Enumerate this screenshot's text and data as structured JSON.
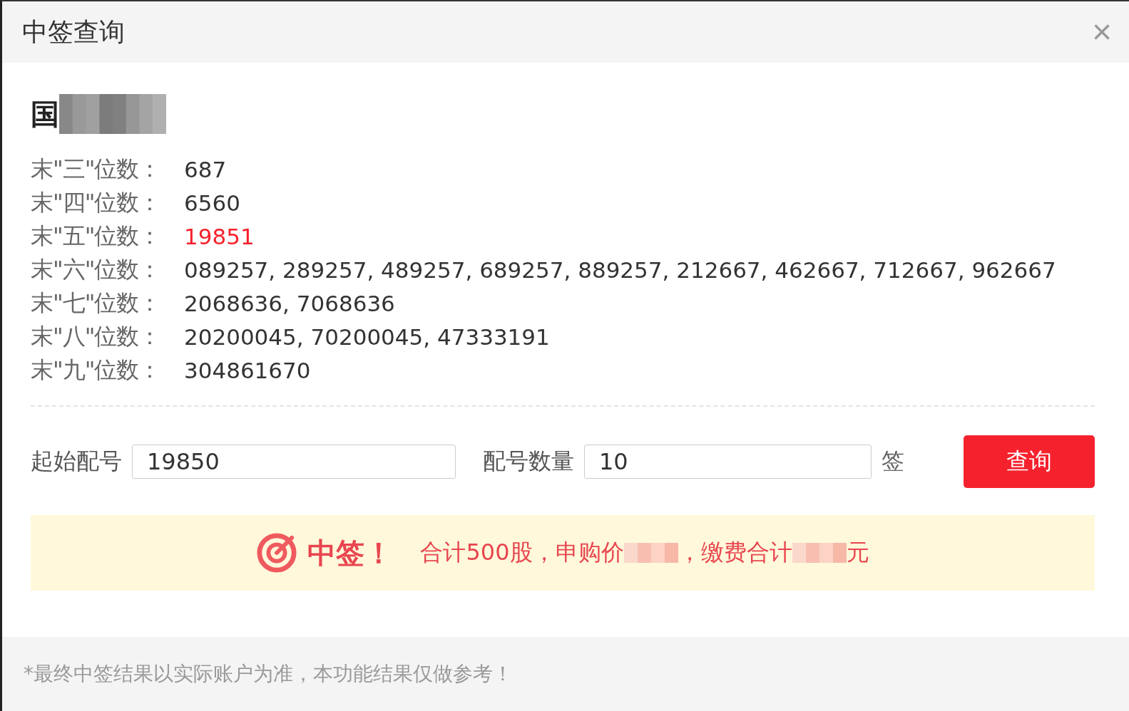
{
  "dialog": {
    "title": "中签查询",
    "close": "×"
  },
  "stock": {
    "name": "国"
  },
  "rows": [
    {
      "label": "末\"三\"位数：",
      "value": "687",
      "highlight": false
    },
    {
      "label": "末\"四\"位数：",
      "value": "6560",
      "highlight": false
    },
    {
      "label": "末\"五\"位数：",
      "value": "19851",
      "highlight": true
    },
    {
      "label": "末\"六\"位数：",
      "value": "089257, 289257, 489257, 689257, 889257, 212667, 462667, 712667, 962667",
      "highlight": false
    },
    {
      "label": "末\"七\"位数：",
      "value": "2068636, 7068636",
      "highlight": false
    },
    {
      "label": "末\"八\"位数：",
      "value": "20200045, 70200045, 47333191",
      "highlight": false
    },
    {
      "label": "末\"九\"位数：",
      "value": "304861670",
      "highlight": false
    }
  ],
  "query": {
    "start_label": "起始配号",
    "start_value": "19850",
    "count_label": "配号数量",
    "count_value": "10",
    "unit": "签",
    "button": "查询"
  },
  "result": {
    "headline": "中签！",
    "segments": [
      {
        "kind": "text",
        "text": "合计500股，申购价"
      },
      {
        "kind": "redacted"
      },
      {
        "kind": "text",
        "text": "，缴费合计"
      },
      {
        "kind": "redacted"
      },
      {
        "kind": "text",
        "text": "元"
      }
    ]
  },
  "footer": {
    "note": "*最终中签结果以实际账户为准，本功能结果仅做参考！"
  }
}
